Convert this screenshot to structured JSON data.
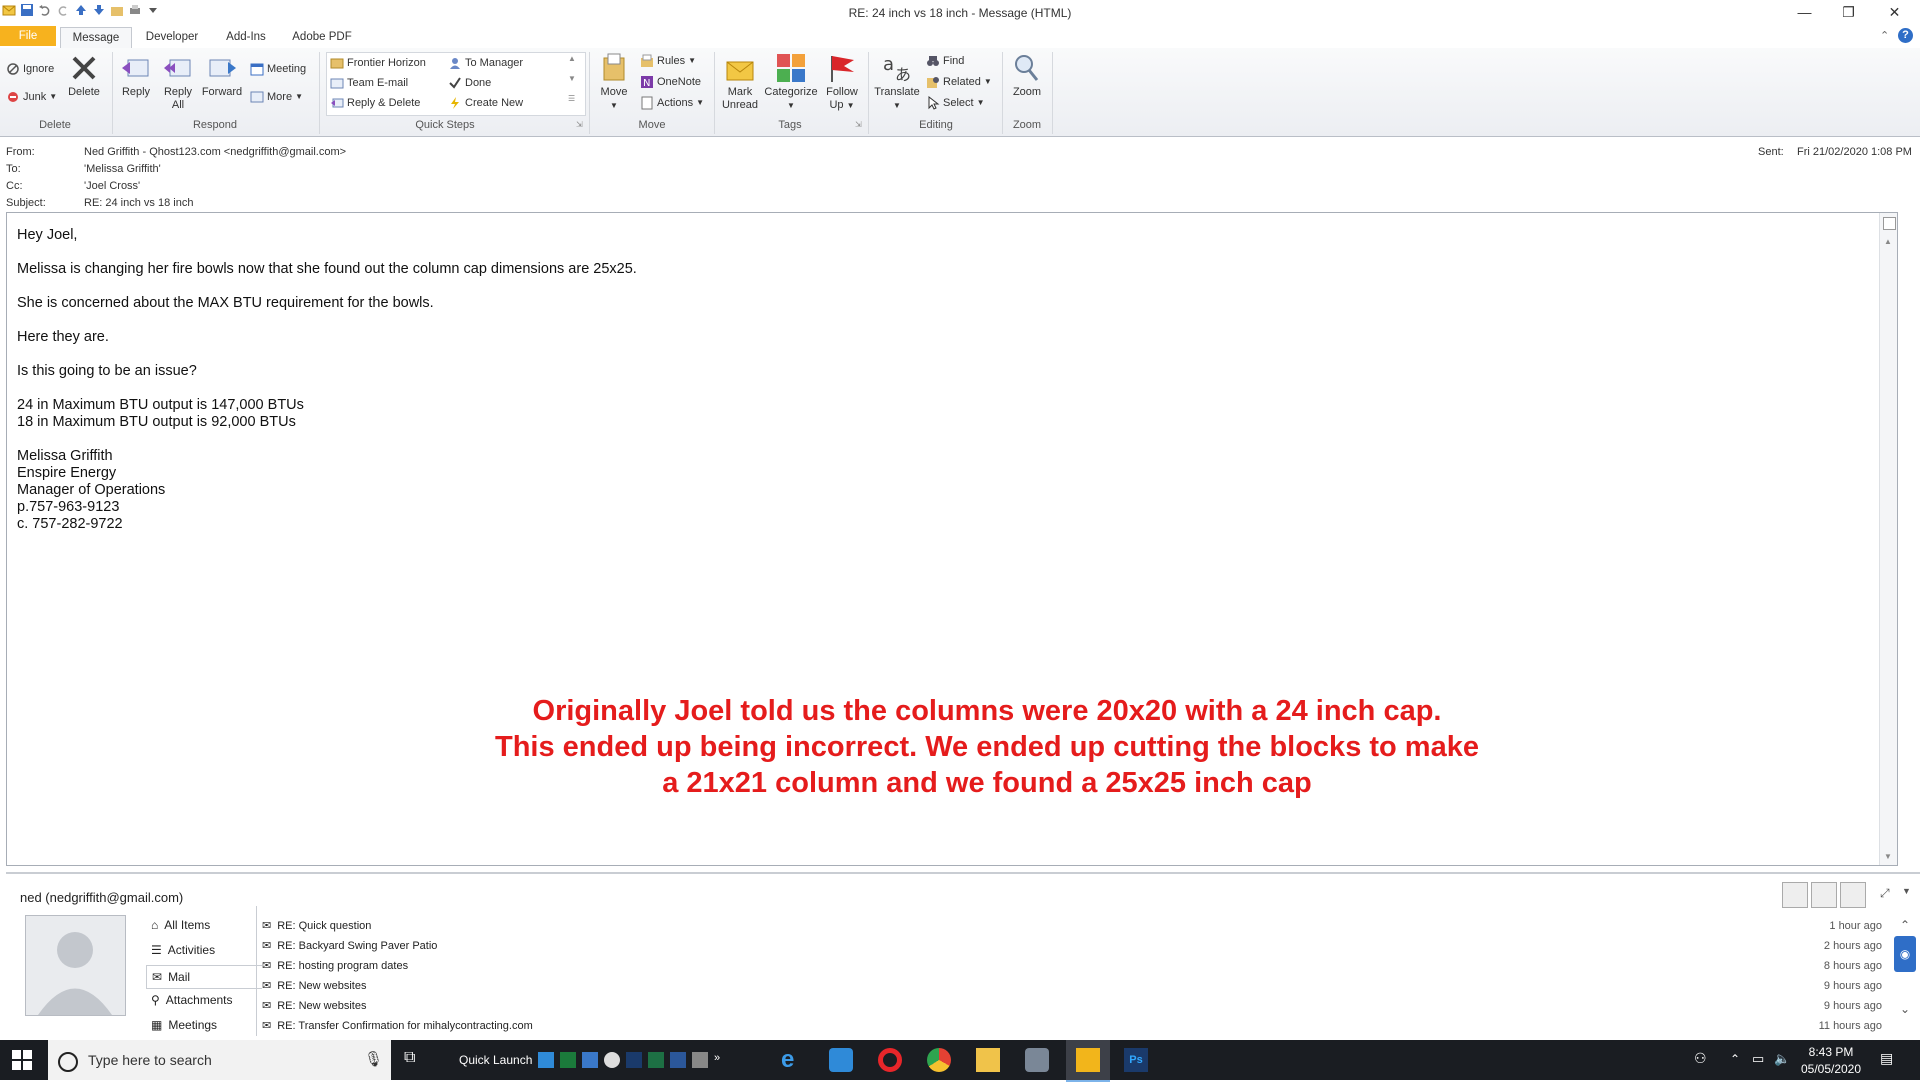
{
  "window": {
    "title": "RE: 24 inch vs 18 inch  -  Message (HTML)",
    "controls": {
      "minimize": "—",
      "restore": "❐",
      "close": "✕"
    }
  },
  "tabs": [
    "File",
    "Message",
    "Developer",
    "Add-Ins",
    "Adobe PDF"
  ],
  "ribbon": {
    "delete": {
      "label": "Delete",
      "ignore": "Ignore",
      "junk": "Junk",
      "delete_btn": "Delete"
    },
    "respond": {
      "label": "Respond",
      "reply": "Reply",
      "reply_all_1": "Reply",
      "reply_all_2": "All",
      "forward": "Forward",
      "meeting": "Meeting",
      "more": "More"
    },
    "quick_steps": {
      "label": "Quick Steps",
      "items": [
        "Frontier Horizon",
        "To Manager",
        "Team E-mail",
        "Done",
        "Reply & Delete",
        "Create New"
      ]
    },
    "move": {
      "label": "Move",
      "move_btn": "Move",
      "rules": "Rules",
      "onenote": "OneNote",
      "actions": "Actions"
    },
    "tags": {
      "label": "Tags",
      "mark_unread_1": "Mark",
      "mark_unread_2": "Unread",
      "categorize": "Categorize",
      "follow_up_1": "Follow",
      "follow_up_2": "Up"
    },
    "editing": {
      "label": "Editing",
      "translate": "Translate",
      "find": "Find",
      "related": "Related",
      "select": "Select"
    },
    "zoom": {
      "label": "Zoom",
      "zoom_btn": "Zoom"
    }
  },
  "header": {
    "from_label": "From:",
    "from": "Ned Griffith - Qhost123.com <nedgriffith@gmail.com>",
    "to_label": "To:",
    "to": "'Melissa Griffith'",
    "cc_label": "Cc:",
    "cc": "'Joel Cross'",
    "subject_label": "Subject:",
    "subject": "RE: 24 inch vs 18 inch",
    "sent_label": "Sent:",
    "sent": "Fri 21/02/2020 1:08 PM"
  },
  "body": {
    "greeting": "Hey Joel,",
    "p1": "Melissa is changing her fire bowls now that she found out the column cap dimensions are 25x25.",
    "p2": "She is concerned about the MAX BTU requirement for the bowls.",
    "p3": "Here they are.",
    "p4": "Is this going to be an issue?",
    "btu1": "24 in Maximum BTU output is 147,000 BTUs",
    "btu2": "18 in Maximum BTU output is 92,000 BTUs",
    "sig_name": "Melissa Griffith",
    "sig_company": "Enspire Energy",
    "sig_title": "Manager of Operations",
    "sig_phone": "p.757-963-9123",
    "sig_cell": "c. 757-282-9722"
  },
  "annotation": {
    "line1": "Originally Joel told us the columns were 20x20 with a 24 inch cap.",
    "line2": "This ended up being incorrect.  We ended up cutting the blocks to make",
    "line3": "a 21x21 column and we found a 25x25 inch cap"
  },
  "people_pane": {
    "account": "ned (nedgriffith@gmail.com)",
    "nav": [
      "All Items",
      "Activities",
      "Mail",
      "Attachments",
      "Meetings"
    ],
    "mails": [
      {
        "subject": "RE: Quick question",
        "time": "1 hour ago"
      },
      {
        "subject": "RE: Backyard Swing Paver Patio",
        "time": "2 hours ago"
      },
      {
        "subject": "RE: hosting program dates",
        "time": "8 hours ago"
      },
      {
        "subject": "RE: New websites",
        "time": "9 hours ago"
      },
      {
        "subject": "RE: New websites",
        "time": "9 hours ago"
      },
      {
        "subject": "RE: Transfer Confirmation for mihalycontracting.com",
        "time": "11 hours ago"
      }
    ]
  },
  "taskbar": {
    "search_placeholder": "Type here to search",
    "quick_launch": "Quick Launch",
    "time": "8:43 PM",
    "date": "05/05/2020"
  }
}
